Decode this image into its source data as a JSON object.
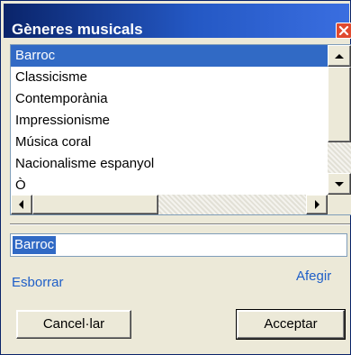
{
  "window": {
    "title": "Gèneres musicals"
  },
  "genre_list": {
    "items": [
      "Barroc",
      "Classicisme",
      "Contemporània",
      "Impressionisme",
      "Música coral",
      "Nacionalisme espanyol",
      "Ò"
    ],
    "selected": "Barroc"
  },
  "name_input": {
    "value": "Barroc"
  },
  "actions": {
    "delete_label": "Esborrar",
    "add_label": "Afegir"
  },
  "buttons": {
    "cancel_label": "Cancel·lar",
    "accept_label": "Acceptar"
  },
  "colors": {
    "title_bar": "#0a246a",
    "selection": "#316ac5",
    "link": "#1f5fc8",
    "close_button": "#e04a2f"
  }
}
